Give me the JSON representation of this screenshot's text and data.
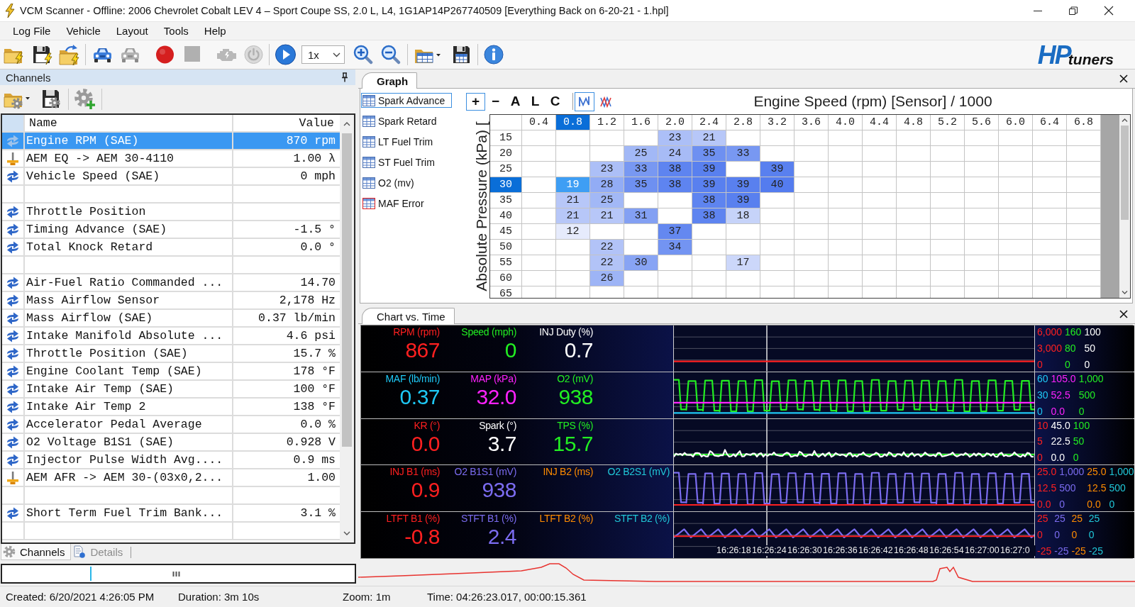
{
  "window": {
    "title": "VCM Scanner - Offline: 2006 Chevrolet Cobalt LEV 4 – Sport Coupe SS, 2.0 L, L4, 1G1AP14P267740509 [Everything Back on 6-20-21 - 1.hpl]"
  },
  "menu": [
    "Log File",
    "Vehicle",
    "Layout",
    "Tools",
    "Help"
  ],
  "toolbar": {
    "items": [
      {
        "kind": "open",
        "disabled": false
      },
      {
        "kind": "save",
        "disabled": false
      },
      {
        "kind": "import",
        "disabled": false
      },
      {
        "kind": "separator"
      },
      {
        "kind": "vehicle",
        "disabled": false
      },
      {
        "kind": "vehicle",
        "disabled": true
      },
      {
        "kind": "record",
        "disabled": false
      },
      {
        "kind": "stop",
        "disabled": true
      },
      {
        "kind": "engine",
        "disabled": true
      },
      {
        "kind": "power",
        "disabled": true
      },
      {
        "kind": "separator"
      },
      {
        "kind": "play",
        "disabled": false
      },
      {
        "kind": "combo",
        "value": "1x"
      },
      {
        "kind": "zoomin",
        "disabled": false
      },
      {
        "kind": "zoomout",
        "disabled": false
      },
      {
        "kind": "separator"
      },
      {
        "kind": "layout",
        "disabled": false
      },
      {
        "kind": "savelayout",
        "disabled": false
      },
      {
        "kind": "separator"
      },
      {
        "kind": "info",
        "disabled": false
      }
    ],
    "logo": {
      "mark": "HP",
      "text": "tuners"
    }
  },
  "channels": {
    "title": "Channels",
    "columns": [
      "Name",
      "Value"
    ],
    "rows": [
      {
        "kind": "pid",
        "name": "Engine RPM (SAE)",
        "value": "870 rpm",
        "selected": true
      },
      {
        "kind": "serial",
        "name": "AEM EQ -> AEM 30-4110",
        "value": "1.00 λ",
        "selected": false
      },
      {
        "kind": "pid",
        "name": "Vehicle Speed (SAE)",
        "value": "0 mph",
        "selected": false
      },
      {
        "kind": "blank",
        "selected": false
      },
      {
        "kind": "pid",
        "name": "Throttle Position",
        "selected": false
      },
      {
        "kind": "pid",
        "name": "Timing Advance (SAE)",
        "value": "-1.5 °",
        "selected": false
      },
      {
        "kind": "pid",
        "name": "Total Knock Retard",
        "value": "0.0 °",
        "selected": false
      },
      {
        "kind": "blank",
        "selected": false
      },
      {
        "kind": "pid",
        "name": "Air-Fuel Ratio Commanded ...",
        "value": "14.70",
        "selected": false
      },
      {
        "kind": "pid",
        "name": "Mass Airflow Sensor",
        "value": "2,178 Hz",
        "selected": false
      },
      {
        "kind": "pid",
        "name": "Mass Airflow (SAE)",
        "value": "0.37 lb/min",
        "selected": false
      },
      {
        "kind": "pid",
        "name": "Intake Manifold Absolute ...",
        "value": "4.6 psi",
        "selected": false
      },
      {
        "kind": "pid",
        "name": "Throttle Position (SAE)",
        "value": "15.7 %",
        "selected": false
      },
      {
        "kind": "pid",
        "name": "Engine Coolant Temp (SAE)",
        "value": "178 °F",
        "selected": false
      },
      {
        "kind": "pid",
        "name": "Intake Air Temp (SAE)",
        "value": "100 °F",
        "selected": false
      },
      {
        "kind": "pid",
        "name": "Intake Air Temp 2",
        "value": "138 °F",
        "selected": false
      },
      {
        "kind": "pid",
        "name": "Accelerator Pedal Average",
        "value": "0.0 %",
        "selected": false
      },
      {
        "kind": "pid",
        "name": "O2 Voltage B1S1 (SAE)",
        "value": "0.928 V",
        "selected": false
      },
      {
        "kind": "pid",
        "name": "Injector Pulse Width Avg....",
        "value": "0.9 ms",
        "selected": false
      },
      {
        "kind": "serial",
        "name": "AEM AFR -> AEM 30-(03x0,2...",
        "value": "1.00",
        "selected": false
      },
      {
        "kind": "blank",
        "selected": false
      },
      {
        "kind": "pid",
        "name": "Short Term Fuel Trim Bank...",
        "value": "3.1 %",
        "selected": false
      },
      {
        "kind": "blank",
        "selected": false
      }
    ],
    "tabs": [
      {
        "label": "Channels",
        "selected": true
      },
      {
        "label": "Details",
        "selected": false
      }
    ]
  },
  "graph": {
    "tab": "Graph",
    "tables": [
      {
        "label": "Spark Advance",
        "kind": "table",
        "selected": true
      },
      {
        "label": "Spark Retard",
        "kind": "table",
        "selected": false
      },
      {
        "label": "LT Fuel Trim",
        "kind": "table",
        "selected": false
      },
      {
        "label": "ST Fuel Trim",
        "kind": "table",
        "selected": false
      },
      {
        "label": "O2 (mv)",
        "kind": "table",
        "selected": false
      },
      {
        "label": "MAF Error",
        "kind": "error",
        "selected": false
      }
    ],
    "tools": [
      {
        "kind": "text",
        "label": "+",
        "selected": true
      },
      {
        "kind": "text",
        "label": "−",
        "selected": false
      },
      {
        "kind": "text",
        "label": "A",
        "selected": false
      },
      {
        "kind": "text",
        "label": "L",
        "selected": false
      },
      {
        "kind": "text",
        "label": "C",
        "selected": false
      },
      {
        "kind": "separator"
      },
      {
        "kind": "wave",
        "selected": true
      },
      {
        "kind": "cross",
        "selected": false
      }
    ],
    "title": "Engine Speed (rpm) [Sensor] / 1000",
    "ylabel": "Absolute Pressure (kPa) [",
    "columns": [
      {
        "label": "0.4",
        "selected": false
      },
      {
        "label": "0.8",
        "selected": true
      },
      {
        "label": "1.2",
        "selected": false
      },
      {
        "label": "1.6",
        "selected": false
      },
      {
        "label": "2.0",
        "selected": false
      },
      {
        "label": "2.4",
        "selected": false
      },
      {
        "label": "2.8",
        "selected": false
      },
      {
        "label": "3.2",
        "selected": false
      },
      {
        "label": "3.6",
        "selected": false
      },
      {
        "label": "4.0",
        "selected": false
      },
      {
        "label": "4.4",
        "selected": false
      },
      {
        "label": "4.8",
        "selected": false
      },
      {
        "label": "5.2",
        "selected": false
      },
      {
        "label": "5.6",
        "selected": false
      },
      {
        "label": "6.0",
        "selected": false
      },
      {
        "label": "6.4",
        "selected": false
      },
      {
        "label": "6.8",
        "selected": false
      }
    ],
    "rows": [
      {
        "label": "15",
        "selected": false,
        "cells": [
          null,
          null,
          null,
          null,
          {
            "value": "23",
            "selected": false
          },
          {
            "value": "21",
            "selected": false
          }
        ]
      },
      {
        "label": "20",
        "selected": false,
        "cells": [
          null,
          null,
          null,
          {
            "value": "25",
            "selected": false
          },
          {
            "value": "24",
            "selected": false
          },
          {
            "value": "35",
            "selected": false
          },
          {
            "value": "33",
            "selected": false
          }
        ]
      },
      {
        "label": "25",
        "selected": false,
        "cells": [
          null,
          null,
          {
            "value": "23",
            "selected": false
          },
          {
            "value": "33",
            "selected": false
          },
          {
            "value": "38",
            "selected": false
          },
          {
            "value": "39",
            "selected": false
          },
          null,
          {
            "value": "39",
            "selected": false
          }
        ]
      },
      {
        "label": "30",
        "selected": true,
        "cells": [
          null,
          {
            "value": "19",
            "selected": true
          },
          {
            "value": "28",
            "selected": false
          },
          {
            "value": "35",
            "selected": false
          },
          {
            "value": "38",
            "selected": false
          },
          {
            "value": "39",
            "selected": false
          },
          {
            "value": "39",
            "selected": false
          },
          {
            "value": "40",
            "selected": false
          }
        ]
      },
      {
        "label": "35",
        "selected": false,
        "cells": [
          null,
          {
            "value": "21",
            "selected": false
          },
          {
            "value": "25",
            "selected": false
          },
          null,
          null,
          {
            "value": "38",
            "selected": false
          },
          {
            "value": "39",
            "selected": false
          }
        ]
      },
      {
        "label": "40",
        "selected": false,
        "cells": [
          null,
          {
            "value": "21",
            "selected": false
          },
          {
            "value": "21",
            "selected": false
          },
          {
            "value": "31",
            "selected": false
          },
          null,
          {
            "value": "38",
            "selected": false
          },
          {
            "value": "18",
            "selected": false
          }
        ]
      },
      {
        "label": "45",
        "selected": false,
        "cells": [
          null,
          {
            "value": "12",
            "selected": false
          },
          null,
          null,
          {
            "value": "37",
            "selected": false
          }
        ]
      },
      {
        "label": "50",
        "selected": false,
        "cells": [
          null,
          null,
          {
            "value": "22",
            "selected": false
          },
          null,
          {
            "value": "34",
            "selected": false
          }
        ]
      },
      {
        "label": "55",
        "selected": false,
        "cells": [
          null,
          null,
          {
            "value": "22",
            "selected": false
          },
          {
            "value": "30",
            "selected": false
          },
          null,
          null,
          {
            "value": "17",
            "selected": false
          }
        ]
      },
      {
        "label": "60",
        "selected": false,
        "cells": [
          null,
          null,
          {
            "value": "26",
            "selected": false
          }
        ]
      },
      {
        "label": "65",
        "selected": false
      }
    ]
  },
  "chart": {
    "tab": "Chart vs. Time",
    "rows": [
      {
        "gauges": [
          {
            "kind": "flat",
            "label": "RPM (rpm)",
            "value": "867",
            "color": "#ff2020",
            "scale": [
              "6,000",
              "3,000",
              "0"
            ]
          },
          {
            "kind": "none",
            "label": "Speed (mph)",
            "value": "0",
            "color": "#22ee22",
            "scale": [
              "160",
              "80",
              "0"
            ]
          },
          {
            "kind": "none",
            "label": "INJ Duty (%)",
            "value": "0.7",
            "color": "#ffffff",
            "scale": [
              "100",
              "50",
              "0"
            ]
          }
        ]
      },
      {
        "gauges": [
          {
            "kind": "flat",
            "label": "MAF (lb/min)",
            "value": "0.37",
            "color": "#1ec8f5",
            "scale": [
              "60",
              "30",
              "0"
            ]
          },
          {
            "kind": "flat",
            "label": "MAP (kPa)",
            "value": "32.0",
            "color": "#ff22ff",
            "scale": [
              "105.0",
              "52.5",
              "0.0"
            ]
          },
          {
            "kind": "square",
            "label": "O2 (mV)",
            "value": "938",
            "color": "#22ee22",
            "scale": [
              "1,000",
              "500",
              "0"
            ]
          }
        ]
      },
      {
        "gauges": [
          {
            "kind": "none",
            "label": "KR (°)",
            "value": "0.0",
            "color": "#ff2020",
            "scale": [
              "10",
              "5",
              "0"
            ]
          },
          {
            "kind": "noise",
            "label": "Spark (°)",
            "value": "3.7",
            "color": "#ffffff",
            "scale": [
              "45.0",
              "22.5",
              "0.0"
            ]
          },
          {
            "kind": "flat",
            "label": "TPS (%)",
            "value": "15.7",
            "color": "#22ee22",
            "scale": [
              "100",
              "50",
              "0"
            ]
          }
        ]
      },
      {
        "gauges": [
          {
            "kind": "flat",
            "label": "INJ B1 (ms)",
            "value": "0.9",
            "color": "#ff2020",
            "scale": [
              "25.0",
              "12.5",
              "0.0"
            ]
          },
          {
            "kind": "square",
            "label": "O2 B1S1 (mV)",
            "value": "938",
            "color": "#7b6cf0",
            "scale": [
              "1,000",
              "500",
              "0"
            ]
          },
          {
            "kind": "none",
            "label": "INJ B2 (ms)",
            "color": "#ff8c00",
            "scale": [
              "25.0",
              "12.5",
              "0.0"
            ]
          },
          {
            "kind": "none",
            "label": "O2 B2S1 (mV)",
            "color": "#20c8d8",
            "scale": [
              "1,000",
              "500",
              "0"
            ]
          }
        ]
      },
      {
        "gauges": [
          {
            "kind": "flat",
            "label": "LTFT B1 (%)",
            "value": "-0.8",
            "color": "#ff2020",
            "scale": [
              "25",
              "0",
              "-25"
            ]
          },
          {
            "kind": "zigzag",
            "label": "STFT B1 (%)",
            "value": "2.4",
            "color": "#7b6cf0",
            "scale": [
              "25",
              "0",
              "-25"
            ]
          },
          {
            "kind": "none",
            "label": "LTFT B2 (%)",
            "color": "#ff8c00",
            "scale": [
              "25",
              "0",
              "-25"
            ]
          },
          {
            "kind": "none",
            "label": "STFT B2 (%)",
            "color": "#20c8d8",
            "scale": [
              "25",
              "0",
              "-25"
            ]
          }
        ]
      }
    ],
    "times": [
      "16:26:18",
      "16:26:24",
      "16:26:30",
      "16:26:36",
      "16:26:42",
      "16:26:48",
      "16:26:54",
      "16:27:00",
      "16:27:0"
    ]
  },
  "status": [
    "Created: 6/20/2021 4:26:05 PM",
    "Duration: 3m 10s",
    "Zoom: 1m",
    "Time: 04:26:23.017, 00:00:15.361"
  ]
}
